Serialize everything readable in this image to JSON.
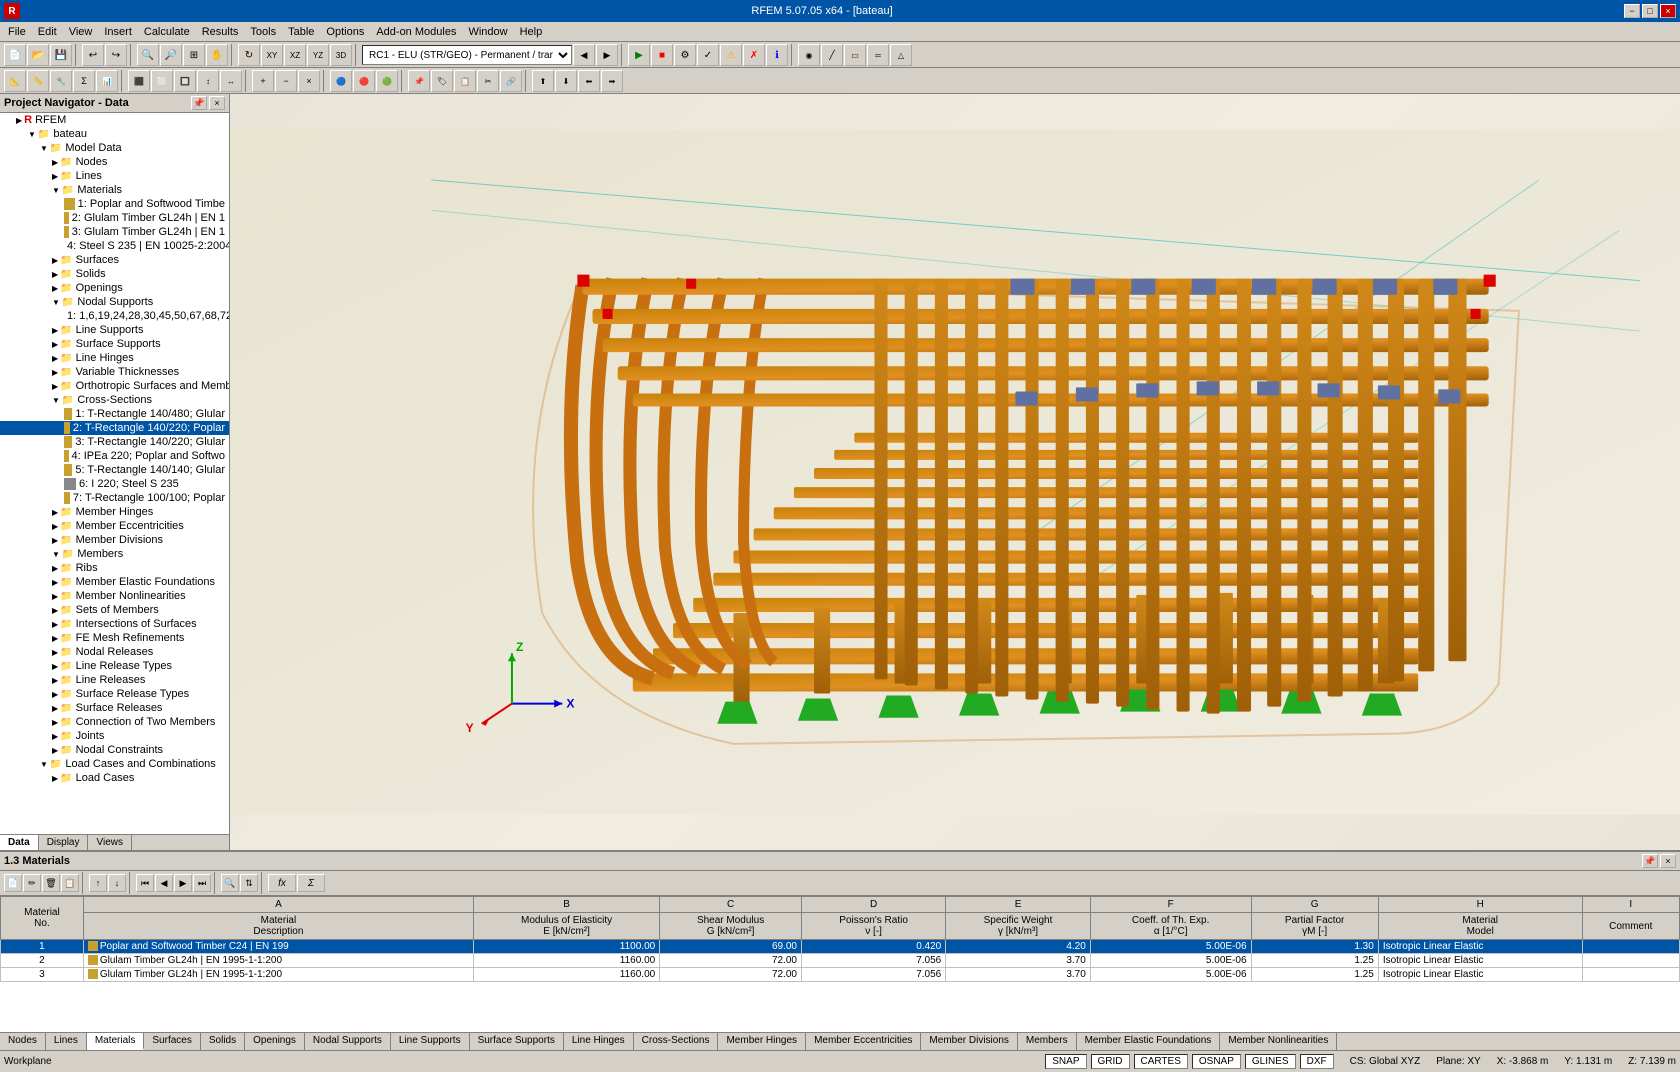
{
  "title_bar": {
    "title": "RFEM 5.07.05 x64 - [bateau]",
    "controls": [
      "−",
      "□",
      "×"
    ]
  },
  "menu": {
    "app_icon": "R",
    "items": [
      "File",
      "Edit",
      "View",
      "Insert",
      "Calculate",
      "Results",
      "Tools",
      "Table",
      "Options",
      "Add-on Modules",
      "Window",
      "Help"
    ]
  },
  "rc_combo": {
    "value": "RC1 - ELU (STR/GEO) - Permanent / trar"
  },
  "project_navigator": {
    "title": "Project Navigator - Data",
    "rfem_label": "RFEM",
    "bateau_label": "bateau",
    "tree": [
      {
        "level": 2,
        "label": "Model Data",
        "type": "folder",
        "expanded": true
      },
      {
        "level": 3,
        "label": "Nodes",
        "type": "folder"
      },
      {
        "level": 3,
        "label": "Lines",
        "type": "folder"
      },
      {
        "level": 3,
        "label": "Materials",
        "type": "folder",
        "expanded": true
      },
      {
        "level": 4,
        "label": "1: Poplar and Softwood Timbe",
        "type": "material",
        "color": "#c8a030"
      },
      {
        "level": 4,
        "label": "2: Glulam Timber GL24h | EN 1",
        "type": "material",
        "color": "#c8a030"
      },
      {
        "level": 4,
        "label": "3: Glulam Timber GL24h | EN 1",
        "type": "material",
        "color": "#c8a030"
      },
      {
        "level": 4,
        "label": "4: Steel S 235 | EN 10025-2:200",
        "type": "material",
        "color": "#888"
      },
      {
        "level": 3,
        "label": "Surfaces",
        "type": "folder"
      },
      {
        "level": 3,
        "label": "Solids",
        "type": "folder"
      },
      {
        "level": 3,
        "label": "Openings",
        "type": "folder"
      },
      {
        "level": 3,
        "label": "Nodal Supports",
        "type": "folder",
        "expanded": true
      },
      {
        "level": 4,
        "label": "1: 1,6,19,24,28,30,45,50,67,68,72",
        "type": "support"
      },
      {
        "level": 3,
        "label": "Line Supports",
        "type": "folder"
      },
      {
        "level": 3,
        "label": "Surface Supports",
        "type": "folder"
      },
      {
        "level": 3,
        "label": "Line Hinges",
        "type": "folder"
      },
      {
        "level": 3,
        "label": "Variable Thicknesses",
        "type": "folder"
      },
      {
        "level": 3,
        "label": "Orthotropic Surfaces and Membra",
        "type": "folder"
      },
      {
        "level": 3,
        "label": "Cross-Sections",
        "type": "folder",
        "expanded": true
      },
      {
        "level": 4,
        "label": "1: T-Rectangle 140/480; Glular",
        "type": "cs",
        "color": "#c8a030"
      },
      {
        "level": 4,
        "label": "2: T-Rectangle 140/220; Poplar",
        "type": "cs",
        "color": "#c8a030",
        "selected": true
      },
      {
        "level": 4,
        "label": "3: T-Rectangle 140/220; Glular",
        "type": "cs",
        "color": "#c8a030"
      },
      {
        "level": 4,
        "label": "4: IPEa 220; Poplar and Softwo",
        "type": "cs",
        "color": "#c8a030"
      },
      {
        "level": 4,
        "label": "5: T-Rectangle 140/140; Glular",
        "type": "cs",
        "color": "#c8a030"
      },
      {
        "level": 4,
        "label": "6: I 220; Steel S 235",
        "type": "cs",
        "color": "#888"
      },
      {
        "level": 4,
        "label": "7: T-Rectangle 100/100; Poplar",
        "type": "cs",
        "color": "#c8a030"
      },
      {
        "level": 3,
        "label": "Member Hinges",
        "type": "folder"
      },
      {
        "level": 3,
        "label": "Member Eccentricities",
        "type": "folder"
      },
      {
        "level": 3,
        "label": "Member Divisions",
        "type": "folder"
      },
      {
        "level": 3,
        "label": "Members",
        "type": "folder",
        "expanded": true
      },
      {
        "level": 3,
        "label": "Ribs",
        "type": "folder"
      },
      {
        "level": 3,
        "label": "Member Elastic Foundations",
        "type": "folder"
      },
      {
        "level": 3,
        "label": "Member Nonlinearities",
        "type": "folder"
      },
      {
        "level": 3,
        "label": "Sets of Members",
        "type": "folder"
      },
      {
        "level": 3,
        "label": "Intersections of Surfaces",
        "type": "folder"
      },
      {
        "level": 3,
        "label": "FE Mesh Refinements",
        "type": "folder"
      },
      {
        "level": 3,
        "label": "Nodal Releases",
        "type": "folder"
      },
      {
        "level": 3,
        "label": "Line Release Types",
        "type": "folder"
      },
      {
        "level": 3,
        "label": "Line Releases",
        "type": "folder"
      },
      {
        "level": 3,
        "label": "Surface Release Types",
        "type": "folder"
      },
      {
        "level": 3,
        "label": "Surface Releases",
        "type": "folder"
      },
      {
        "level": 3,
        "label": "Connection of Two Members",
        "type": "folder"
      },
      {
        "level": 3,
        "label": "Joints",
        "type": "folder"
      },
      {
        "level": 3,
        "label": "Nodal Constraints",
        "type": "folder"
      },
      {
        "level": 2,
        "label": "Load Cases and Combinations",
        "type": "folder",
        "expanded": true
      },
      {
        "level": 3,
        "label": "Load Cases",
        "type": "folder"
      }
    ]
  },
  "nav_tabs": [
    "Data",
    "Display",
    "Views"
  ],
  "bottom_panel": {
    "title": "1.3 Materials"
  },
  "table": {
    "columns": [
      {
        "id": "A",
        "header1": "A",
        "header2": "Material",
        "header3": "Description"
      },
      {
        "id": "B",
        "header1": "B",
        "header2": "Modulus of Elasticity",
        "header3": "E [kN/cm²]"
      },
      {
        "id": "C",
        "header1": "C",
        "header2": "Shear Modulus",
        "header3": "G [kN/cm²]"
      },
      {
        "id": "D",
        "header1": "D",
        "header2": "Poisson's Ratio",
        "header3": "ν [-]"
      },
      {
        "id": "E",
        "header1": "E",
        "header2": "Specific Weight",
        "header3": "γ [kN/m³]"
      },
      {
        "id": "F",
        "header1": "F",
        "header2": "Coeff. of Th. Exp.",
        "header3": "α [1/°C]"
      },
      {
        "id": "G",
        "header1": "G",
        "header2": "Partial Factor",
        "header3": "γM [-]"
      },
      {
        "id": "H",
        "header1": "H",
        "header2": "Material",
        "header3": "Model"
      },
      {
        "id": "I",
        "header1": "I",
        "header2": "",
        "header3": "Comment"
      }
    ],
    "row_header": "Material No.",
    "rows": [
      {
        "no": 1,
        "color": "#c8a030",
        "desc": "Poplar and Softwood Timber C24 | EN 199",
        "E": "1100.00",
        "G": "69.00",
        "nu": "0.420",
        "gamma": "4.20",
        "alpha": "5.00E-06",
        "partial": "1.30",
        "model": "Isotropic Linear Elastic",
        "comment": "",
        "selected": true
      },
      {
        "no": 2,
        "color": "#c8a030",
        "desc": "Glulam Timber GL24h | EN 1995-1-1:200",
        "E": "1160.00",
        "G": "72.00",
        "nu": "7.056",
        "gamma": "3.70",
        "alpha": "5.00E-06",
        "partial": "1.25",
        "model": "Isotropic Linear Elastic",
        "comment": ""
      },
      {
        "no": 3,
        "color": "#c8a030",
        "desc": "Glulam Timber GL24h | EN 1995-1-1:200",
        "E": "1160.00",
        "G": "72.00",
        "nu": "7.056",
        "gamma": "3.70",
        "alpha": "5.00E-06",
        "partial": "1.25",
        "model": "Isotropic Linear Elastic",
        "comment": ""
      }
    ]
  },
  "bottom_tabs": [
    "Nodes",
    "Lines",
    "Materials",
    "Surfaces",
    "Solids",
    "Openings",
    "Nodal Supports",
    "Line Supports",
    "Surface Supports",
    "Line Hinges",
    "Cross-Sections",
    "Member Hinges",
    "Member Eccentricities",
    "Member Divisions",
    "Members",
    "Member Elastic Foundations",
    "Member Nonlinearities"
  ],
  "status_bar": {
    "workplane": "Workplane",
    "snap": "SNAP",
    "grid": "GRID",
    "cartes": "CARTES",
    "osnap": "OSNAP",
    "glines": "GLINES",
    "dxf": "DXF",
    "cs": "CS: Global XYZ",
    "plane": "Plane: XY",
    "x": "X:  -3.868 m",
    "y": "Y:  1.131 m",
    "z": "Z:  7.139 m"
  }
}
